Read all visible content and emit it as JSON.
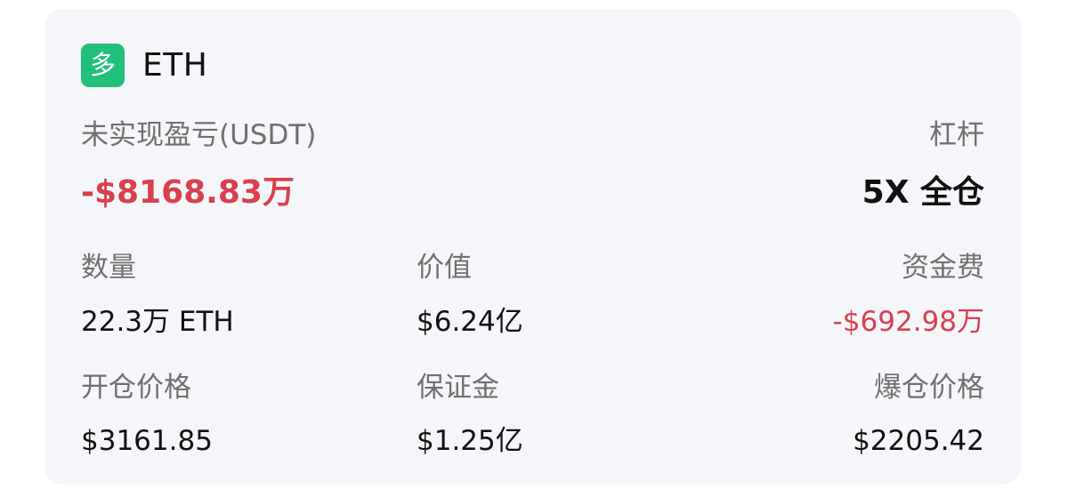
{
  "position": {
    "side_badge": "多",
    "symbol": "ETH",
    "colors": {
      "long_badge": "#22c07a",
      "negative": "#d9404f",
      "card_bg": "#f5f6f9"
    }
  },
  "pnl": {
    "label": "未实现盈亏(USDT)",
    "value": "-$8168.83万"
  },
  "leverage": {
    "label": "杠杆",
    "value": "5X 全仓"
  },
  "quantity": {
    "label": "数量",
    "value": "22.3万 ETH"
  },
  "position_value": {
    "label": "价值",
    "value": "$6.24亿"
  },
  "funding_fee": {
    "label": "资金费",
    "value": "-$692.98万"
  },
  "entry_price": {
    "label": "开仓价格",
    "value": "$3161.85"
  },
  "margin": {
    "label": "保证金",
    "value": "$1.25亿"
  },
  "liquidation_price": {
    "label": "爆仓价格",
    "value": "$2205.42"
  }
}
